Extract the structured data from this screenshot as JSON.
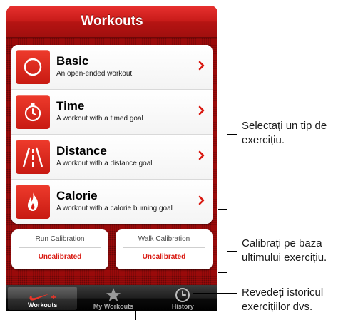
{
  "navbar": {
    "title": "Workouts"
  },
  "workouts": [
    {
      "name": "Basic",
      "description": "An open-ended workout",
      "icon": "circle-icon"
    },
    {
      "name": "Time",
      "description": "A workout with a timed goal",
      "icon": "stopwatch-icon"
    },
    {
      "name": "Distance",
      "description": "A workout with a distance goal",
      "icon": "road-icon"
    },
    {
      "name": "Calorie",
      "description": "A workout with a calorie burning goal",
      "icon": "flame-icon"
    }
  ],
  "calibration": {
    "run": {
      "title": "Run Calibration",
      "status": "Uncalibrated"
    },
    "walk": {
      "title": "Walk Calibration",
      "status": "Uncalibrated"
    }
  },
  "tabs": [
    {
      "label": "Workouts",
      "icon": "nike-swoosh-icon",
      "selected": true
    },
    {
      "label": "My Workouts",
      "icon": "star-icon",
      "selected": false
    },
    {
      "label": "History",
      "icon": "clock-icon",
      "selected": false
    }
  ],
  "callouts": {
    "workout_type": [
      "Selectați un tip de",
      "exercițiu."
    ],
    "calibrate": [
      "Calibrați pe baza",
      "ultimului exercițiu."
    ],
    "history": [
      "Revedeți istoricul",
      "exercițiilor dvs."
    ]
  },
  "colors": {
    "accent": "#d91a12",
    "background": "#a10b0b",
    "tabbar": "#1e1e1e"
  }
}
